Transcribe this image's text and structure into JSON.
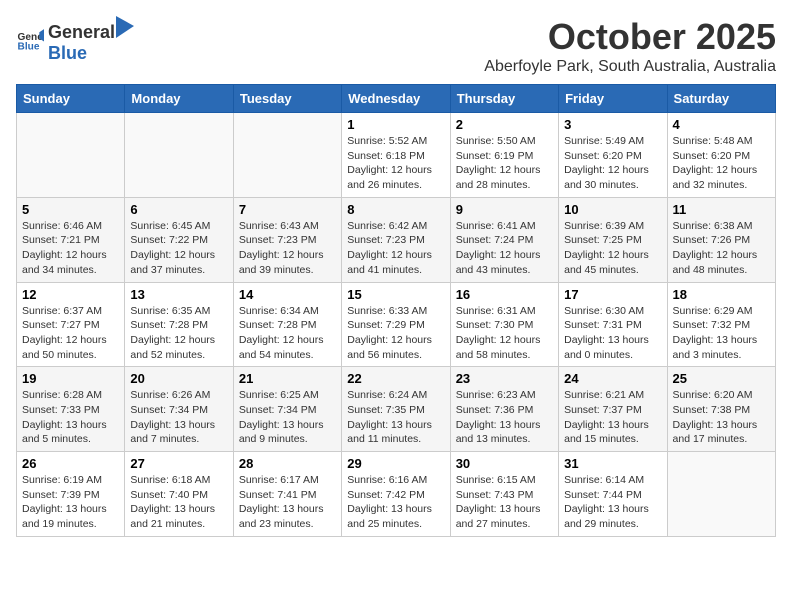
{
  "header": {
    "logo_general": "General",
    "logo_blue": "Blue",
    "month_title": "October 2025",
    "subtitle": "Aberfoyle Park, South Australia, Australia"
  },
  "days_of_week": [
    "Sunday",
    "Monday",
    "Tuesday",
    "Wednesday",
    "Thursday",
    "Friday",
    "Saturday"
  ],
  "weeks": [
    [
      {
        "day": "",
        "sunrise": "",
        "sunset": "",
        "daylight": ""
      },
      {
        "day": "",
        "sunrise": "",
        "sunset": "",
        "daylight": ""
      },
      {
        "day": "",
        "sunrise": "",
        "sunset": "",
        "daylight": ""
      },
      {
        "day": "1",
        "sunrise": "Sunrise: 5:52 AM",
        "sunset": "Sunset: 6:18 PM",
        "daylight": "Daylight: 12 hours and 26 minutes."
      },
      {
        "day": "2",
        "sunrise": "Sunrise: 5:50 AM",
        "sunset": "Sunset: 6:19 PM",
        "daylight": "Daylight: 12 hours and 28 minutes."
      },
      {
        "day": "3",
        "sunrise": "Sunrise: 5:49 AM",
        "sunset": "Sunset: 6:20 PM",
        "daylight": "Daylight: 12 hours and 30 minutes."
      },
      {
        "day": "4",
        "sunrise": "Sunrise: 5:48 AM",
        "sunset": "Sunset: 6:20 PM",
        "daylight": "Daylight: 12 hours and 32 minutes."
      }
    ],
    [
      {
        "day": "5",
        "sunrise": "Sunrise: 6:46 AM",
        "sunset": "Sunset: 7:21 PM",
        "daylight": "Daylight: 12 hours and 34 minutes."
      },
      {
        "day": "6",
        "sunrise": "Sunrise: 6:45 AM",
        "sunset": "Sunset: 7:22 PM",
        "daylight": "Daylight: 12 hours and 37 minutes."
      },
      {
        "day": "7",
        "sunrise": "Sunrise: 6:43 AM",
        "sunset": "Sunset: 7:23 PM",
        "daylight": "Daylight: 12 hours and 39 minutes."
      },
      {
        "day": "8",
        "sunrise": "Sunrise: 6:42 AM",
        "sunset": "Sunset: 7:23 PM",
        "daylight": "Daylight: 12 hours and 41 minutes."
      },
      {
        "day": "9",
        "sunrise": "Sunrise: 6:41 AM",
        "sunset": "Sunset: 7:24 PM",
        "daylight": "Daylight: 12 hours and 43 minutes."
      },
      {
        "day": "10",
        "sunrise": "Sunrise: 6:39 AM",
        "sunset": "Sunset: 7:25 PM",
        "daylight": "Daylight: 12 hours and 45 minutes."
      },
      {
        "day": "11",
        "sunrise": "Sunrise: 6:38 AM",
        "sunset": "Sunset: 7:26 PM",
        "daylight": "Daylight: 12 hours and 48 minutes."
      }
    ],
    [
      {
        "day": "12",
        "sunrise": "Sunrise: 6:37 AM",
        "sunset": "Sunset: 7:27 PM",
        "daylight": "Daylight: 12 hours and 50 minutes."
      },
      {
        "day": "13",
        "sunrise": "Sunrise: 6:35 AM",
        "sunset": "Sunset: 7:28 PM",
        "daylight": "Daylight: 12 hours and 52 minutes."
      },
      {
        "day": "14",
        "sunrise": "Sunrise: 6:34 AM",
        "sunset": "Sunset: 7:28 PM",
        "daylight": "Daylight: 12 hours and 54 minutes."
      },
      {
        "day": "15",
        "sunrise": "Sunrise: 6:33 AM",
        "sunset": "Sunset: 7:29 PM",
        "daylight": "Daylight: 12 hours and 56 minutes."
      },
      {
        "day": "16",
        "sunrise": "Sunrise: 6:31 AM",
        "sunset": "Sunset: 7:30 PM",
        "daylight": "Daylight: 12 hours and 58 minutes."
      },
      {
        "day": "17",
        "sunrise": "Sunrise: 6:30 AM",
        "sunset": "Sunset: 7:31 PM",
        "daylight": "Daylight: 13 hours and 0 minutes."
      },
      {
        "day": "18",
        "sunrise": "Sunrise: 6:29 AM",
        "sunset": "Sunset: 7:32 PM",
        "daylight": "Daylight: 13 hours and 3 minutes."
      }
    ],
    [
      {
        "day": "19",
        "sunrise": "Sunrise: 6:28 AM",
        "sunset": "Sunset: 7:33 PM",
        "daylight": "Daylight: 13 hours and 5 minutes."
      },
      {
        "day": "20",
        "sunrise": "Sunrise: 6:26 AM",
        "sunset": "Sunset: 7:34 PM",
        "daylight": "Daylight: 13 hours and 7 minutes."
      },
      {
        "day": "21",
        "sunrise": "Sunrise: 6:25 AM",
        "sunset": "Sunset: 7:34 PM",
        "daylight": "Daylight: 13 hours and 9 minutes."
      },
      {
        "day": "22",
        "sunrise": "Sunrise: 6:24 AM",
        "sunset": "Sunset: 7:35 PM",
        "daylight": "Daylight: 13 hours and 11 minutes."
      },
      {
        "day": "23",
        "sunrise": "Sunrise: 6:23 AM",
        "sunset": "Sunset: 7:36 PM",
        "daylight": "Daylight: 13 hours and 13 minutes."
      },
      {
        "day": "24",
        "sunrise": "Sunrise: 6:21 AM",
        "sunset": "Sunset: 7:37 PM",
        "daylight": "Daylight: 13 hours and 15 minutes."
      },
      {
        "day": "25",
        "sunrise": "Sunrise: 6:20 AM",
        "sunset": "Sunset: 7:38 PM",
        "daylight": "Daylight: 13 hours and 17 minutes."
      }
    ],
    [
      {
        "day": "26",
        "sunrise": "Sunrise: 6:19 AM",
        "sunset": "Sunset: 7:39 PM",
        "daylight": "Daylight: 13 hours and 19 minutes."
      },
      {
        "day": "27",
        "sunrise": "Sunrise: 6:18 AM",
        "sunset": "Sunset: 7:40 PM",
        "daylight": "Daylight: 13 hours and 21 minutes."
      },
      {
        "day": "28",
        "sunrise": "Sunrise: 6:17 AM",
        "sunset": "Sunset: 7:41 PM",
        "daylight": "Daylight: 13 hours and 23 minutes."
      },
      {
        "day": "29",
        "sunrise": "Sunrise: 6:16 AM",
        "sunset": "Sunset: 7:42 PM",
        "daylight": "Daylight: 13 hours and 25 minutes."
      },
      {
        "day": "30",
        "sunrise": "Sunrise: 6:15 AM",
        "sunset": "Sunset: 7:43 PM",
        "daylight": "Daylight: 13 hours and 27 minutes."
      },
      {
        "day": "31",
        "sunrise": "Sunrise: 6:14 AM",
        "sunset": "Sunset: 7:44 PM",
        "daylight": "Daylight: 13 hours and 29 minutes."
      },
      {
        "day": "",
        "sunrise": "",
        "sunset": "",
        "daylight": ""
      }
    ]
  ]
}
